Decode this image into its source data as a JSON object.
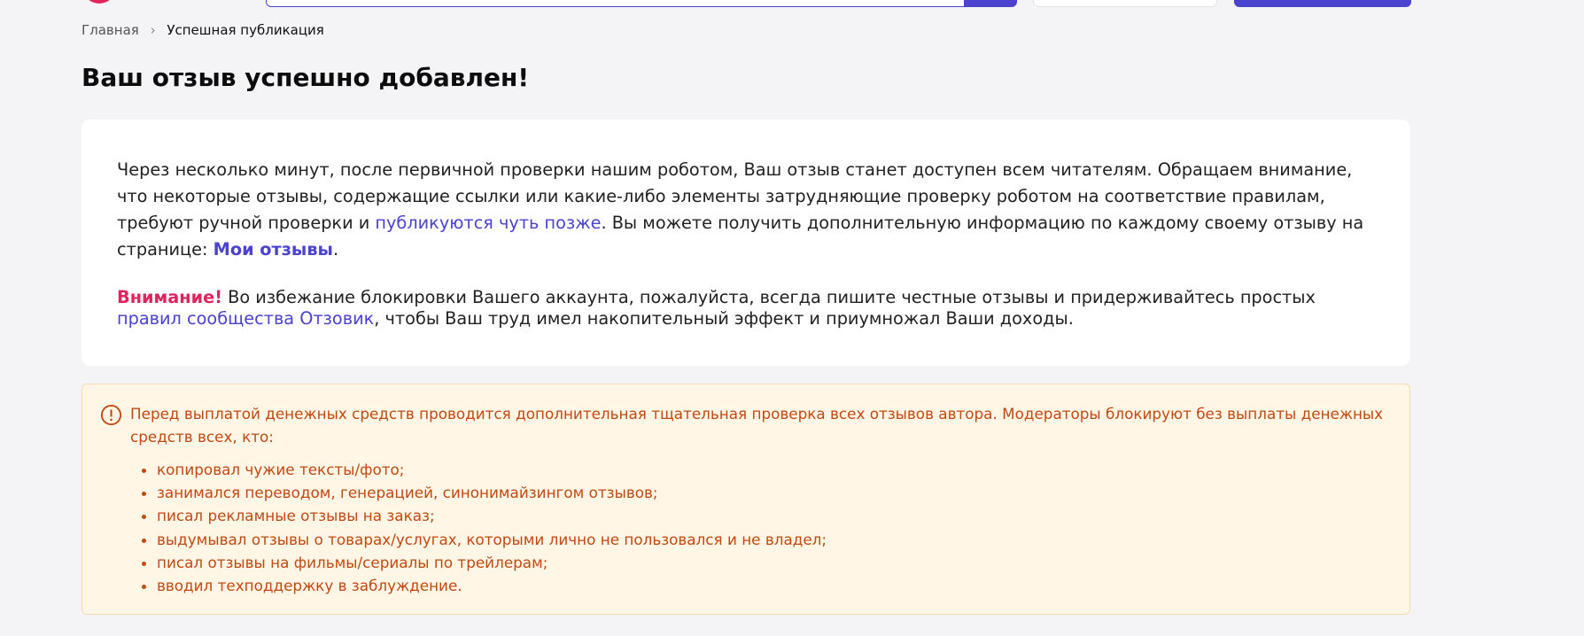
{
  "colors": {
    "accent": "#4b42cf",
    "brand": "#e3245b",
    "attention": "#e0245e",
    "warning_text": "#c24a12",
    "warning_bg": "#fff6e5",
    "page_bg": "#f4f4f7"
  },
  "header": {
    "logo_icon": "brand-logo-icon",
    "search_icon": "search-icon"
  },
  "breadcrumb": {
    "home": "Главная",
    "separator": "›",
    "current": "Успешная публикация"
  },
  "page": {
    "title": "Ваш отзыв успешно добавлен!"
  },
  "info": {
    "para1_text1": "Через несколько минут, после первичной проверки нашим роботом, Ваш отзыв станет доступен всем читателям. Обращаем внимание, что некоторые отзывы, содержащие ссылки или какие-либо элементы затрудняющие проверку роботом на соответствие правилам, требуют ручной проверки и ",
    "para1_link1": "публикуются чуть позже",
    "para1_text2": ". Вы можете получить дополнительную информацию по каждому своему отзыву на странице: ",
    "para1_link2": "Мои отзывы",
    "para1_text3": ".",
    "attention_label": "Внимание!",
    "para2_text1": " Во избежание блокировки Вашего аккаунта, пожалуйста, всегда пишите честные отзывы и придерживайтесь простых ",
    "para2_link": "правил сообщества Отзовик",
    "para2_text2": ", чтобы Ваш труд имел накопительный эффект и приумножал Ваши доходы."
  },
  "warning": {
    "icon": "exclamation-circle-icon",
    "text": "Перед выплатой денежных средств проводится дополнительная тщательная проверка всех отзывов автора. Модераторы блокируют без выплаты денежных средств всех, кто:",
    "items": [
      "копировал чужие тексты/фото;",
      "занимался переводом, генерацией, синонимайзингом отзывов;",
      "писал рекламные отзывы на заказ;",
      "выдумывал отзывы о товарах/услугах, которыми лично не пользовался и не владел;",
      "писал отзывы на фильмы/сериалы по трейлерам;",
      "вводил техподдержку в заблуждение."
    ]
  }
}
